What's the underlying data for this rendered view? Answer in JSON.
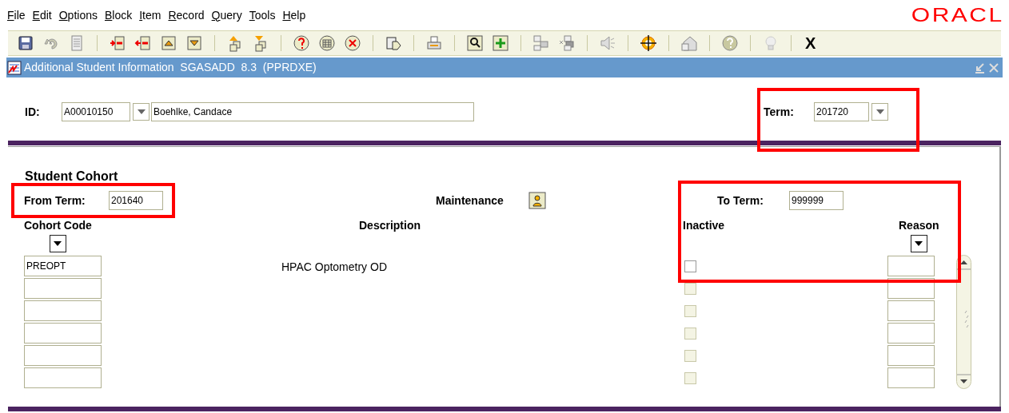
{
  "menu": [
    {
      "label": "File"
    },
    {
      "label": "Edit"
    },
    {
      "label": "Options"
    },
    {
      "label": "Block"
    },
    {
      "label": "Item"
    },
    {
      "label": "Record"
    },
    {
      "label": "Query"
    },
    {
      "label": "Tools"
    },
    {
      "label": "Help"
    }
  ],
  "brand": "ORACL",
  "toolbar": {
    "exit_label": "X"
  },
  "window": {
    "title": "Additional Student Information  SGASADD  8.3  (PPRDXE)"
  },
  "key_block": {
    "id_label": "ID:",
    "id_value": "A00010150",
    "name_value": "Boehlke, Candace",
    "term_label": "Term:",
    "term_value": "201720"
  },
  "cohort": {
    "title": "Student Cohort",
    "from_term_label": "From Term:",
    "from_term_value": "201640",
    "maintenance_label": "Maintenance",
    "to_term_label": "To Term:",
    "to_term_value": "999999",
    "columns": [
      "Cohort Code",
      "Description",
      "Inactive",
      "Reason"
    ],
    "rows": [
      {
        "code": "PREOPT",
        "description": "HPAC Optometry OD",
        "inactive": false,
        "disabled": false
      },
      {
        "inactive": false,
        "disabled": true
      },
      {
        "inactive": false,
        "disabled": true
      },
      {
        "inactive": false,
        "disabled": true
      },
      {
        "inactive": false,
        "disabled": true
      },
      {
        "inactive": false,
        "disabled": true
      }
    ]
  }
}
